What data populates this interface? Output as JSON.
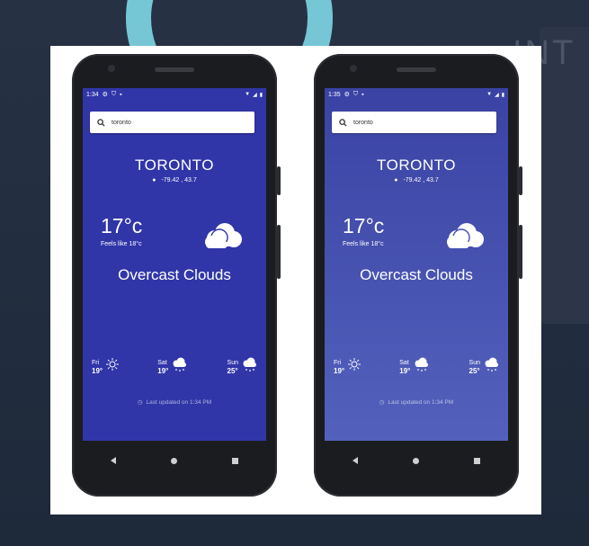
{
  "background": {
    "brand_text": "INT"
  },
  "phones": [
    {
      "status_time": "1:34",
      "search_value": "toronto",
      "city": "TORONTO",
      "coords": "-79.42 , 43.7",
      "temperature": "17°c",
      "feels_like": "Feels like 18°c",
      "condition": "Overcast Clouds",
      "forecast": [
        {
          "day": "Fri",
          "temp": "19°",
          "icon": "sun-icon"
        },
        {
          "day": "Sat",
          "temp": "19°",
          "icon": "snow-cloud-icon"
        },
        {
          "day": "Sun",
          "temp": "25°",
          "icon": "snow-cloud-icon"
        }
      ],
      "updated": "Last updated on 1:34 PM"
    },
    {
      "status_time": "1:35",
      "search_value": "toronto",
      "city": "TORONTO",
      "coords": "-79.42 , 43.7",
      "temperature": "17°c",
      "feels_like": "Feels like 18°c",
      "condition": "Overcast Clouds",
      "forecast": [
        {
          "day": "Fri",
          "temp": "19°",
          "icon": "sun-icon"
        },
        {
          "day": "Sat",
          "temp": "19°",
          "icon": "snow-cloud-icon"
        },
        {
          "day": "Sun",
          "temp": "25°",
          "icon": "snow-cloud-icon"
        }
      ],
      "updated": "Last updated on 1:34 PM"
    }
  ],
  "colors": {
    "left_screen": "#3036a8",
    "right_screen_top": "#3a43a4",
    "right_screen_bottom": "#5361bc",
    "logo_accent": "#7fd7e7"
  }
}
